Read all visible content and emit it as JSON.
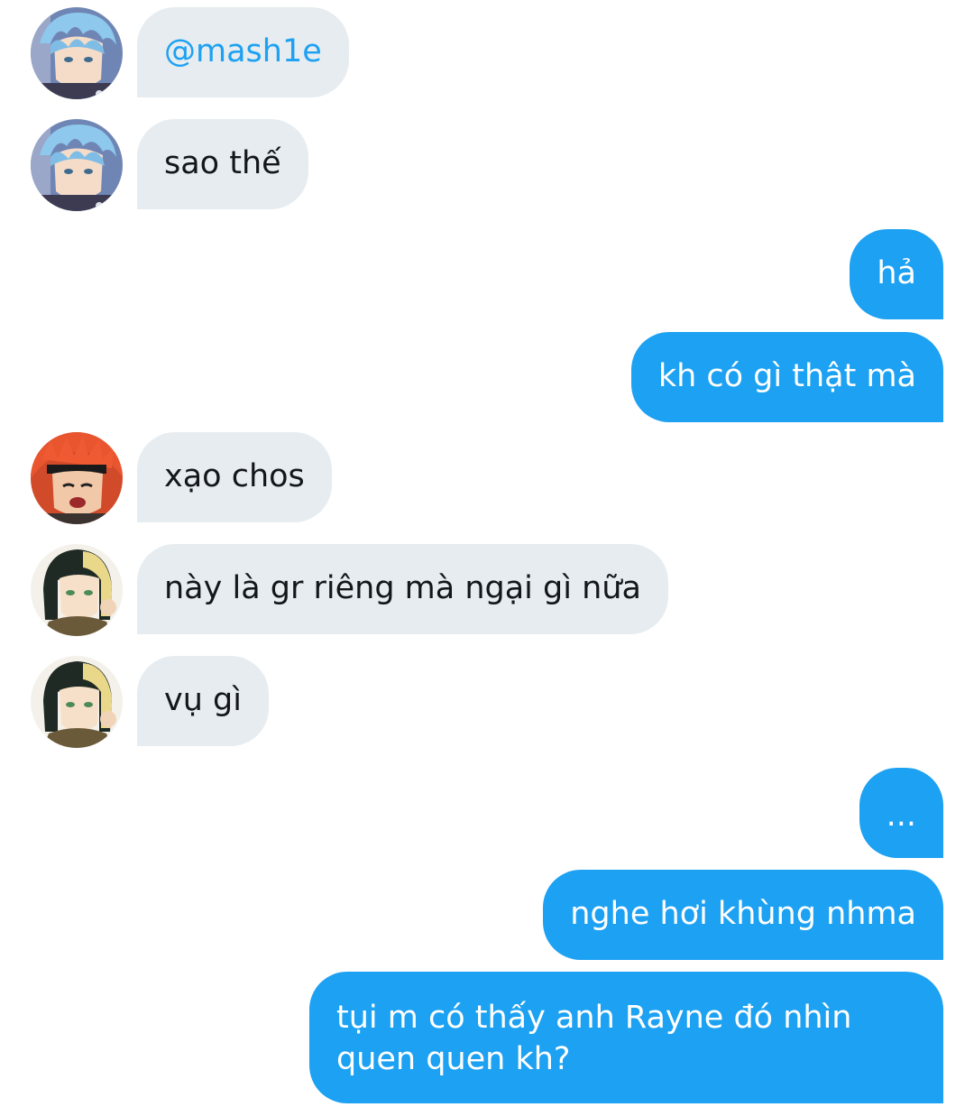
{
  "conversation": {
    "messages": [
      {
        "side": "incoming",
        "sender_avatar": "blue-hair-avatar",
        "text": "@mash1e"
      },
      {
        "side": "incoming",
        "sender_avatar": "blue-hair-avatar",
        "text": "sao thế"
      },
      {
        "side": "outgoing",
        "text": "hả"
      },
      {
        "side": "outgoing",
        "text": "kh có gì thật mà"
      },
      {
        "side": "incoming",
        "sender_avatar": "red-hair-avatar",
        "text": "xạo chos"
      },
      {
        "side": "incoming",
        "sender_avatar": "two-tone-hair-avatar",
        "text": "này là gr riêng mà ngại gì nữa"
      },
      {
        "side": "incoming",
        "sender_avatar": "two-tone-hair-avatar",
        "text": "vụ gì"
      },
      {
        "side": "outgoing",
        "text": "..."
      },
      {
        "side": "outgoing",
        "text": "nghe hơi khùng nhma"
      },
      {
        "side": "outgoing",
        "text": "tụi m có thấy anh Rayne đó nhìn quen quen kh?"
      }
    ]
  },
  "colors": {
    "incoming_bubble": "#e6ecf0",
    "outgoing_bubble": "#1da1f2",
    "mention_text": "#1da1f2",
    "incoming_text": "#14171a",
    "outgoing_text": "#ffffff"
  }
}
